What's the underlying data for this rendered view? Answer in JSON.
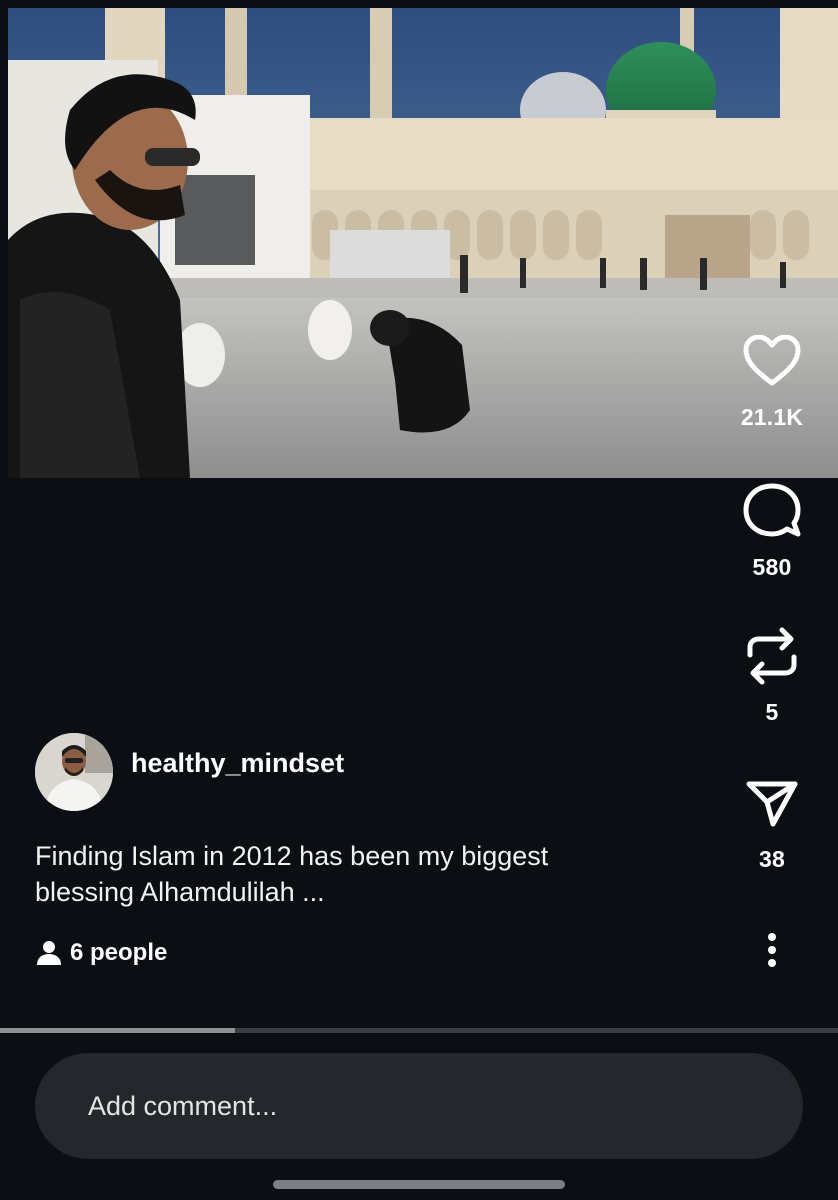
{
  "colors": {
    "background": "#0b0e12",
    "comment_field": "#24272c",
    "progress_fill": "#8d8f93",
    "progress_track": "#3a3d42"
  },
  "video": {
    "description_icon": "video-frame-image",
    "progress": 0.28
  },
  "actions": {
    "like": {
      "icon": "heart-icon",
      "count": "21.1K"
    },
    "comment": {
      "icon": "comment-bubble-icon",
      "count": "580"
    },
    "repost": {
      "icon": "repost-icon",
      "count": "5"
    },
    "share": {
      "icon": "send-icon",
      "count": "38"
    },
    "more": {
      "icon": "more-vertical-icon"
    }
  },
  "post": {
    "username": "healthy_mindset",
    "caption_line1": "Finding Islam in 2012 has been my biggest",
    "caption_line2": "blessing Alhamdulilah ...",
    "people_label": "6 people"
  },
  "comment_input": {
    "placeholder": "Add comment..."
  }
}
